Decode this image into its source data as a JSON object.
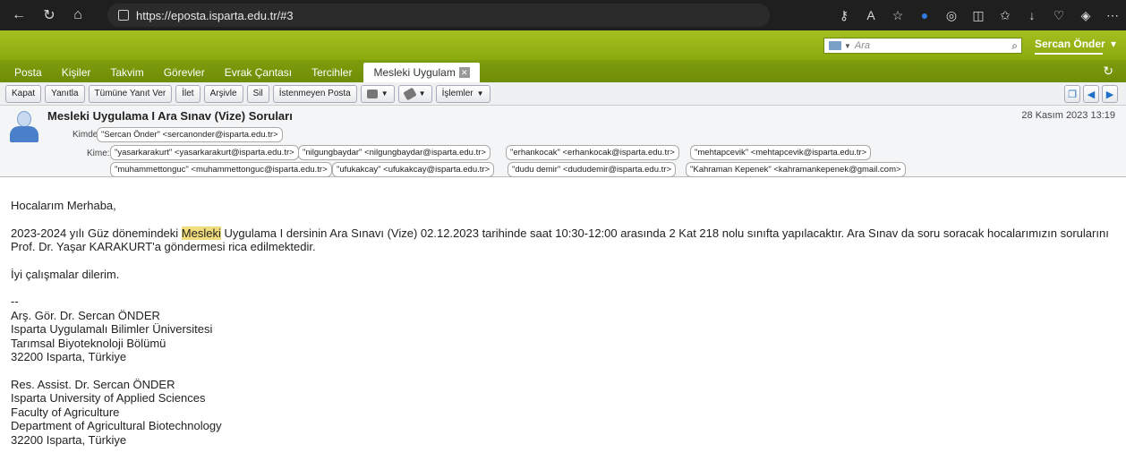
{
  "browser": {
    "url": "https://eposta.isparta.edu.tr/#3"
  },
  "header": {
    "search_placeholder": "Ara",
    "user_name": "Sercan Önder",
    "user_caret": "▾"
  },
  "tabs": [
    {
      "label": "Posta"
    },
    {
      "label": "Kişiler"
    },
    {
      "label": "Takvim"
    },
    {
      "label": "Görevler"
    },
    {
      "label": "Evrak Çantası"
    },
    {
      "label": "Tercihler"
    },
    {
      "label": "Mesleki Uygulam",
      "active": true
    }
  ],
  "toolbar": {
    "buttons": [
      "Kapat",
      "Yanıtla",
      "Tümüne Yanıt Ver",
      "İlet",
      "Arşivle",
      "Sil",
      "İstenmeyen Posta"
    ],
    "actions_label": "İşlemler"
  },
  "message": {
    "subject": "Mesleki Uygulama I Ara Sınav (Vize) Soruları",
    "date": "28 Kasım 2023 13:19",
    "from_label": "Kimden:",
    "from": "\"Sercan Önder\" <sercanonder@isparta.edu.tr>",
    "to_label": "Kime:",
    "to_row1": [
      "\"yasarkarakurt\" <yasarkarakurt@isparta.edu.tr>",
      "\"nilgungbaydar\" <nilgungbaydar@isparta.edu.tr>",
      "\"erhankocak\" <erhankocak@isparta.edu.tr>",
      "\"mehtapcevik\" <mehtapcevik@isparta.edu.tr>"
    ],
    "to_row2": [
      "\"muhammettonguc\" <muhammettonguc@isparta.edu.tr>",
      "\"ufukakcay\" <ufukakcay@isparta.edu.tr>",
      "\"dudu demir\" <dududemir@isparta.edu.tr>",
      "\"Kahraman Kepenek\" <kahramankepenek@gmail.com>"
    ]
  },
  "body": {
    "greeting": "Hocalarım Merhaba,",
    "para_pre": "2023-2024 yılı Güz dönemindeki ",
    "para_hl": "Mesleki",
    "para_post": " Uygulama I dersinin Ara Sınavı (Vize) 02.12.2023 tarihinde saat 10:30-12:00 arasında 2 Kat 218 nolu sınıfta yapılacaktır. Ara Sınav da soru soracak hocalarımızın sorularını Prof. Dr. Yaşar KARAKURT'a göndermesi rica edilmektedir.",
    "closing": "İyi çalışmalar dilerim.",
    "sig_sep": "--",
    "sig_tr": [
      "Arş. Gör. Dr. Sercan ÖNDER",
      "Isparta Uygulamalı Bilimler Üniversitesi",
      "Tarımsal Biyoteknoloji Bölümü",
      "32200 Isparta, Türkiye"
    ],
    "sig_en": [
      "Res. Assist. Dr. Sercan ÖNDER",
      "Isparta University of Applied Sciences",
      "Faculty of Agriculture",
      "Department of Agricultural Biotechnology",
      "32200 Isparta, Türkiye"
    ]
  }
}
